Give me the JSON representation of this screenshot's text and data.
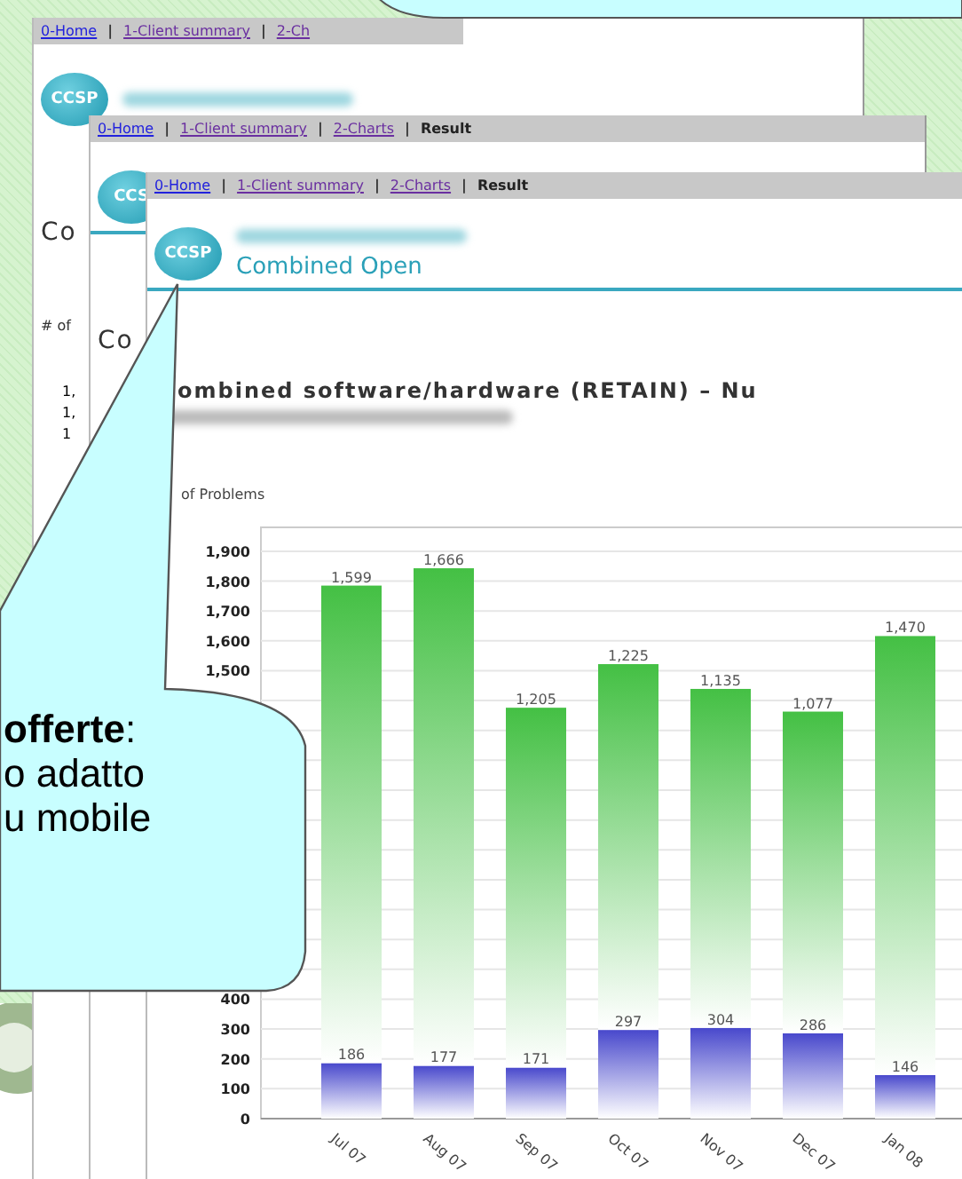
{
  "windows": [
    {
      "nav": [
        {
          "kind": "link",
          "text": "0-Home",
          "visited": false
        },
        {
          "kind": "separator",
          "text": "|"
        },
        {
          "kind": "link",
          "text": "1-Client summary",
          "visited": true
        },
        {
          "kind": "separator",
          "text": "|"
        },
        {
          "kind": "link",
          "text": "2-Ch",
          "visited": true
        }
      ],
      "logo": "CCSP",
      "heading": "Co",
      "label": "# of",
      "values": [
        "1,",
        "1,",
        "1"
      ]
    },
    {
      "nav": [
        {
          "kind": "link",
          "text": "0-Home",
          "visited": false
        },
        {
          "kind": "separator",
          "text": "|"
        },
        {
          "kind": "link",
          "text": "1-Client summary",
          "visited": true
        },
        {
          "kind": "separator",
          "text": "|"
        },
        {
          "kind": "link",
          "text": "2-Charts",
          "visited": true
        },
        {
          "kind": "separator",
          "text": "|"
        },
        {
          "kind": "current",
          "text": "Result"
        }
      ],
      "logo": "CCS",
      "heading": "Co"
    },
    {
      "nav": [
        {
          "kind": "link",
          "text": "0-Home",
          "visited": false
        },
        {
          "kind": "separator",
          "text": "|"
        },
        {
          "kind": "link",
          "text": "1-Client summary",
          "visited": true
        },
        {
          "kind": "separator",
          "text": "|"
        },
        {
          "kind": "link",
          "text": "2-Charts",
          "visited": true
        },
        {
          "kind": "separator",
          "text": "|"
        },
        {
          "kind": "current",
          "text": "Result"
        }
      ],
      "logo": "CCSP",
      "subtitle": "Combined Open",
      "chart_title": "ombined software/hardware (RETAIN) – Nu",
      "axis_label": "of Problems",
      "chart_data": {
        "type": "bar",
        "stacked": true,
        "grid": true,
        "categories": [
          "Jul 07",
          "Aug 07",
          "Sep 07",
          "Oct 07",
          "Nov 07",
          "Dec 07",
          "Jan 08"
        ],
        "series": [
          {
            "color": "#4848cc",
            "values": [
              186,
              177,
              171,
              297,
              304,
              286,
              146
            ],
            "value_labels": [
              "186",
              "177",
              "171",
              "297",
              "304",
              "286",
              "146"
            ]
          },
          {
            "color": "#44c044",
            "values": [
              1599,
              1666,
              1205,
              1225,
              1135,
              1077,
              1470
            ],
            "value_labels": [
              "1,599",
              "1,666",
              "1,205",
              "1,225",
              "1,135",
              "1,077",
              "1,470"
            ]
          }
        ],
        "ylim": [
          0,
          1980
        ],
        "yticks": [
          0,
          100,
          200,
          300,
          400,
          {
            "value": 1500,
            "label": "1,500"
          },
          {
            "value": 1600,
            "label": "1,600"
          },
          {
            "value": 1700,
            "label": "1,700"
          },
          {
            "value": 1800,
            "label": "1,800"
          },
          {
            "value": 1900,
            "label": "1,900"
          }
        ]
      }
    }
  ],
  "callout": {
    "text": "**offerte**:\no adatto\nu mobile"
  }
}
